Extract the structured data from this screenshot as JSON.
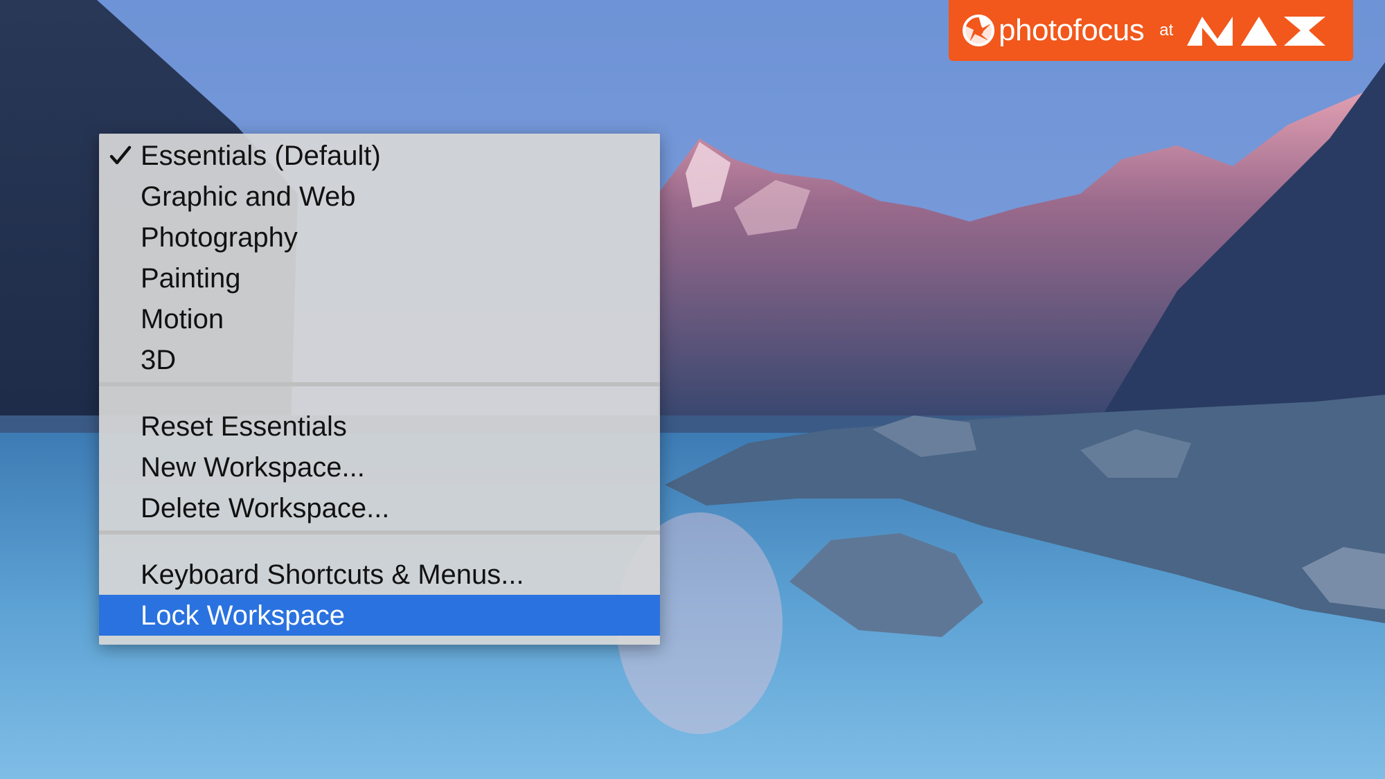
{
  "badge": {
    "brand": "photofocus",
    "connector": "at",
    "event_logo_icon": "max-logo-icon",
    "brand_icon": "aperture-logo-icon",
    "color": "#f2571b"
  },
  "menu": {
    "groups": [
      {
        "items": [
          {
            "label": "Essentials (Default)",
            "checked": true
          },
          {
            "label": "Graphic and Web"
          },
          {
            "label": "Photography"
          },
          {
            "label": "Painting"
          },
          {
            "label": "Motion"
          },
          {
            "label": "3D"
          }
        ]
      },
      {
        "items": [
          {
            "label": "Reset Essentials"
          },
          {
            "label": "New Workspace..."
          },
          {
            "label": "Delete Workspace..."
          }
        ]
      },
      {
        "items": [
          {
            "label": "Keyboard Shortcuts & Menus..."
          },
          {
            "label": "Lock Workspace",
            "highlighted": true
          }
        ]
      }
    ],
    "highlight_color": "#2a72df",
    "check_icon": "checkmark-icon"
  }
}
